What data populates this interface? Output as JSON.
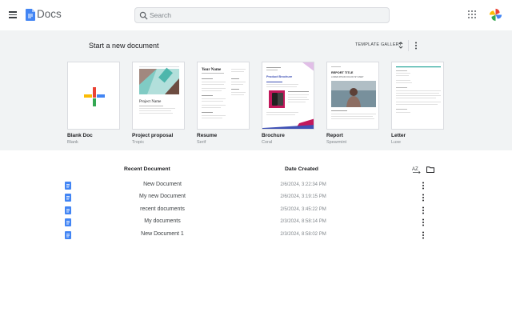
{
  "header": {
    "app_name": "Docs",
    "search_placeholder": "Search"
  },
  "gallery": {
    "title": "Start a new document",
    "template_gallery_label": "TEMPLATE GALLERY",
    "templates": [
      {
        "name": "Blank Doc",
        "sub": "Blank"
      },
      {
        "name": "Project proposal",
        "sub": "Tropic"
      },
      {
        "name": "Resume",
        "sub": "Serif"
      },
      {
        "name": "Brochure",
        "sub": "Coral"
      },
      {
        "name": "Report",
        "sub": "Spearmint"
      },
      {
        "name": "Letter",
        "sub": "Luxe"
      }
    ],
    "thumbnails": {
      "project_title": "Project Name",
      "resume_name": "Your Name",
      "brochure_title": "Product Brochure",
      "report_title": "REPORT TITLE",
      "report_sub": "LOREM IPSUM DOLOR SIT AMET"
    }
  },
  "recent": {
    "col_name": "Recent Document",
    "col_date": "Date Created",
    "sort_label": "AZ",
    "rows": [
      {
        "name": "New Document",
        "date": "2/6/2024, 3:22:34 PM"
      },
      {
        "name": "My new Document",
        "date": "2/6/2024, 3:19:15 PM"
      },
      {
        "name": "recent documents",
        "date": "2/5/2024, 3:45:22 PM"
      },
      {
        "name": "My documents",
        "date": "2/3/2024, 8:58:14 PM"
      },
      {
        "name": "New Document 1",
        "date": "2/3/2024, 8:58:02 PM"
      }
    ]
  },
  "colors": {
    "docs_blue": "#4285f4",
    "gallery_bg": "#f1f3f4",
    "text_muted": "#80868b"
  }
}
